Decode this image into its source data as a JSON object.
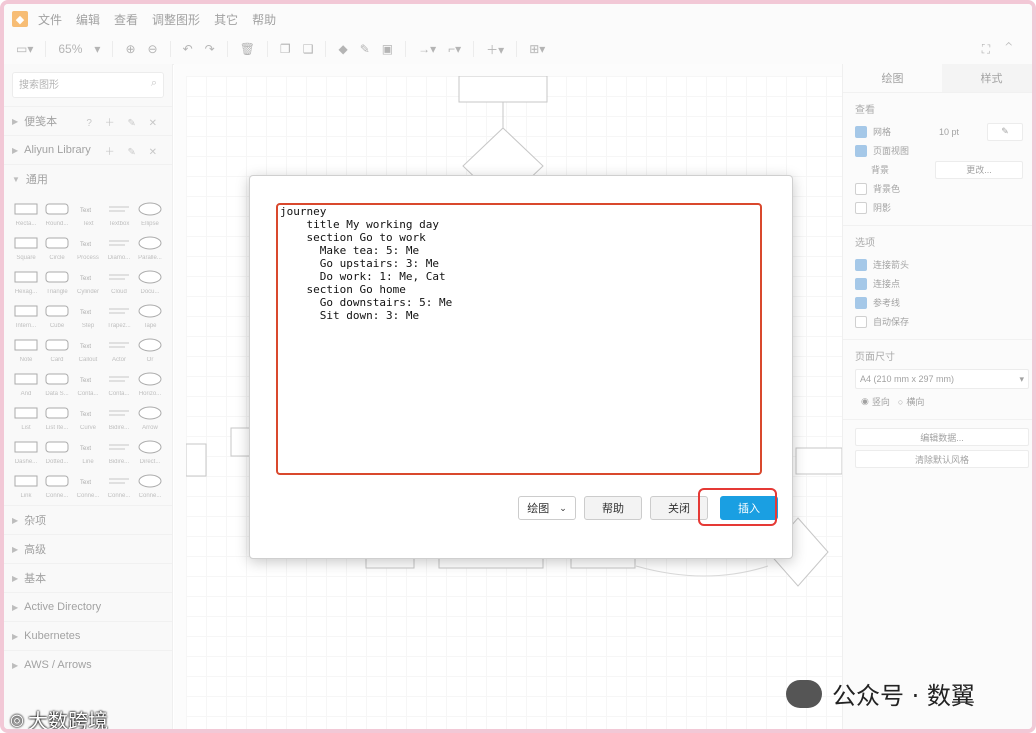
{
  "menu": [
    "文件",
    "编辑",
    "查看",
    "调整图形",
    "其它",
    "帮助"
  ],
  "toolbar": {
    "zoom": "65%"
  },
  "left_panel": {
    "search_placeholder": "搜索图形",
    "sections_top": [
      "便笺本",
      "Aliyun Library",
      "通用"
    ],
    "shapes": [
      "Recta...",
      "Round...",
      "Text",
      "Textbox",
      "Ellipse",
      "Square",
      "Circle",
      "Process",
      "Diamo...",
      "Paralle...",
      "Hexag...",
      "Triangle",
      "Cylinder",
      "Cloud",
      "Docu...",
      "Intern...",
      "Cube",
      "Step",
      "Trapez...",
      "Tape",
      "Note",
      "Card",
      "Callout",
      "Actor",
      "Or",
      "And",
      "Data S...",
      "Conta...",
      "Conta...",
      "Horizo...",
      "List",
      "List Ite...",
      "Curve",
      "Bidire...",
      "Arrow",
      "Dashe...",
      "Dotted...",
      "Line",
      "Bidire...",
      "Direct...",
      "Link",
      "Conne...",
      "Conne...",
      "Conne...",
      "Conne..."
    ],
    "sections_bottom": [
      "杂项",
      "高级",
      "基本",
      "Active Directory",
      "Kubernetes",
      "AWS / Arrows"
    ]
  },
  "right_panel": {
    "tabs": [
      "绘图",
      "样式"
    ],
    "view": {
      "title": "查看",
      "grid": "网格",
      "grid_size": "10 pt",
      "page_view": "页面视图",
      "background": "背景",
      "change": "更改...",
      "bg_color": "背景色",
      "shadow": "阴影"
    },
    "options": {
      "title": "选项",
      "items": [
        "连接箭头",
        "连接点",
        "参考线",
        "自动保存"
      ]
    },
    "page_size": {
      "title": "页面尺寸",
      "value": "A4 (210 mm x 297 mm)",
      "portrait": "竖向",
      "landscape": "横向"
    },
    "edit_data": "编辑数据...",
    "clear_style": "清除默认风格"
  },
  "dialog": {
    "code": "journey\n    title My working day\n    section Go to work\n      Make tea: 5: Me\n      Go upstairs: 3: Me\n      Do work: 1: Me, Cat\n    section Go home\n      Go downstairs: 5: Me\n      Sit down: 3: Me",
    "type_select": "绘图",
    "help": "帮助",
    "close": "关闭",
    "insert": "插入"
  },
  "watermark": "公众号 · 数翼",
  "brand": "大数跨境"
}
